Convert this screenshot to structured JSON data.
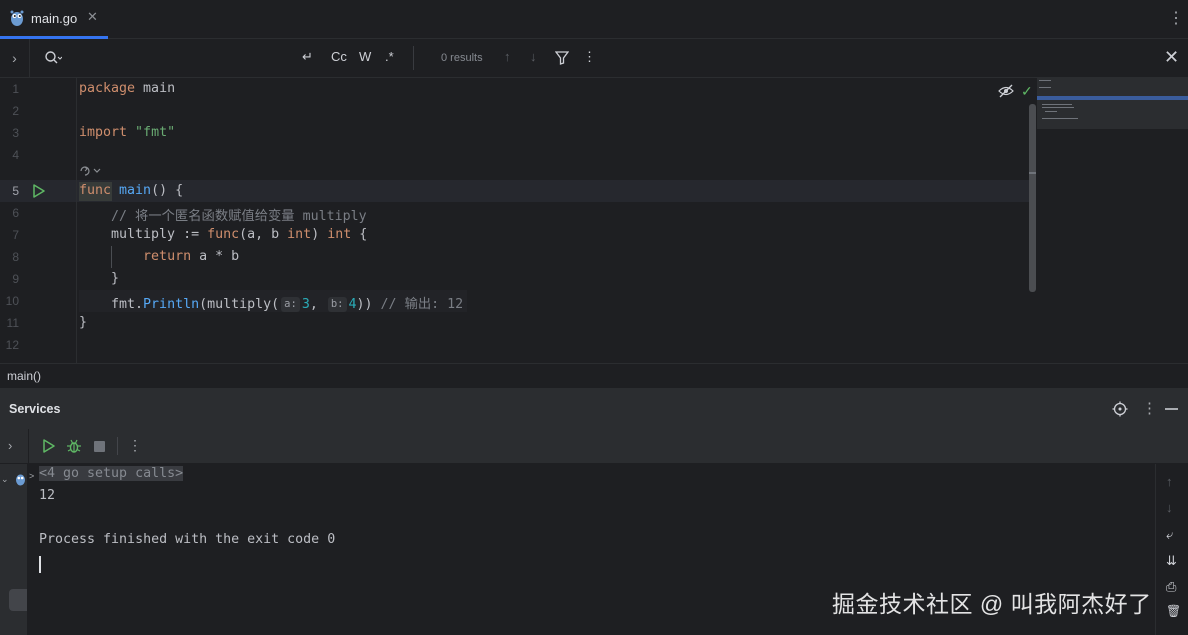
{
  "tab": {
    "title": "main.go",
    "close": "✕",
    "icon": "gopher-icon"
  },
  "tabbar": {
    "more": "⋮"
  },
  "search": {
    "expand": "›",
    "placeholder": "",
    "value": "",
    "buttons": {
      "newline": "↵",
      "match_case": "Cc",
      "whole_word": "W",
      "regex": ".*"
    },
    "results": "0 results",
    "prev": "↑",
    "next": "↓",
    "filter_icon": "filter-icon",
    "more": "⋮",
    "close": "✕"
  },
  "editor": {
    "line_numbers": [
      "1",
      "2",
      "3",
      "4",
      "5",
      "6",
      "7",
      "8",
      "9",
      "10",
      "11",
      "12"
    ],
    "lines": {
      "l1_kw": "package",
      "l1_rest": " main",
      "l3_kw": "import",
      "l3_str": " \"fmt\"",
      "l5_kw": "func",
      "l5_fn": " main",
      "l5_rest": "() {",
      "l6": "    // 将一个匿名函数赋值给变量 multiply",
      "l7_a": "    multiply := ",
      "l7_kw1": "func",
      "l7_b": "(a, b ",
      "l7_kw2": "int",
      "l7_c": ") ",
      "l7_kw3": "int",
      "l7_d": " {",
      "l8_indent": "        ",
      "l8_kw": "return",
      "l8_rest": " a * b",
      "l9": "    }",
      "l10_a": "    fmt.",
      "l10_fn": "Println",
      "l10_b": "(multiply(",
      "l10_hint_a": "a:",
      "l10_num_a": "3",
      "l10_comma": ", ",
      "l10_hint_b": "b:",
      "l10_num_b": "4",
      "l10_c": ")) ",
      "l10_cmt": "// 输出: 12",
      "l11": "}"
    },
    "generate_icon": "generate-icon",
    "check": "✓"
  },
  "breadcrumb": "main()",
  "services": {
    "title": "Services",
    "more": "⋮",
    "toolbar_expand": "›",
    "toolbar_more": "⋮",
    "tree_chevron": "⌄",
    "console": {
      "setup_chevron": ">",
      "setup_calls": "<4 go setup calls>",
      "output": "12",
      "finished": "Process finished with the exit code 0"
    },
    "side": {
      "up": "↑",
      "down": "↓",
      "wrap": "⤶",
      "scroll_end": "⇊",
      "print": "⎙",
      "trash": "🗑"
    }
  },
  "watermark": "掘金技术社区 @ 叫我阿杰好了"
}
